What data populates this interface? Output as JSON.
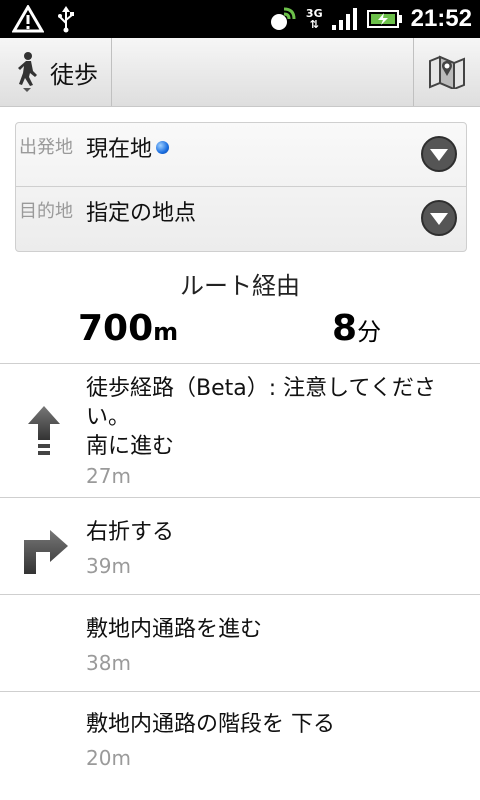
{
  "status_bar": {
    "time": "21:52",
    "network": "3G",
    "icons": [
      "warning-icon",
      "usb-icon",
      "gps-icon",
      "network-3g-icon",
      "signal-icon",
      "battery-icon"
    ]
  },
  "header": {
    "mode_label": "徒歩",
    "mode_icon": "walking-person-icon",
    "map_icon": "map-icon"
  },
  "route": {
    "origin_label": "出発地",
    "origin_value": "現在地",
    "destination_label": "目的地",
    "destination_value": "指定の地点"
  },
  "summary": {
    "title": "ルート経由",
    "distance_value": "700",
    "distance_unit": "m",
    "time_value": "8",
    "time_unit": "分"
  },
  "steps": [
    {
      "line1": "徒歩経路（Beta）: 注意してくださ",
      "line2": "い。",
      "line3": "南に進む",
      "distance": "27m",
      "icon": "arrow-up-icon"
    },
    {
      "text": "右折する",
      "distance": "39m",
      "icon": "turn-right-icon"
    },
    {
      "text": "敷地内通路を進む",
      "distance": "38m"
    },
    {
      "text": "敷地内通路の階段を 下る",
      "distance": "20m"
    }
  ],
  "colors": {
    "status_bar_bg": "#000000",
    "label_gray": "#9a9a9a",
    "location_dot": "#1a6ee0"
  }
}
